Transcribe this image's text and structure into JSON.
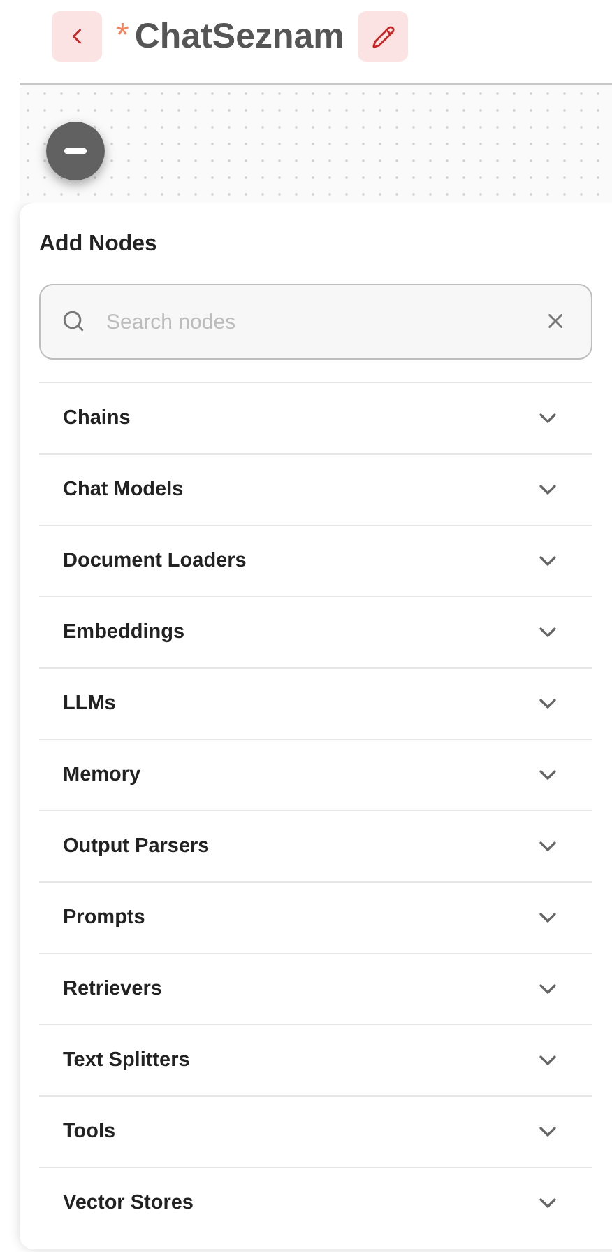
{
  "header": {
    "unsaved_mark": "*",
    "title": "ChatSeznam"
  },
  "panel": {
    "title": "Add Nodes",
    "search": {
      "placeholder": "Search nodes"
    },
    "categories": [
      {
        "label": "Chains",
        "expanded": false
      },
      {
        "label": "Chat Models",
        "expanded": false
      },
      {
        "label": "Document Loaders",
        "expanded": false
      },
      {
        "label": "Embeddings",
        "expanded": false
      },
      {
        "label": "LLMs",
        "expanded": false
      },
      {
        "label": "Memory",
        "expanded": false
      },
      {
        "label": "Output Parsers",
        "expanded": false
      },
      {
        "label": "Prompts",
        "expanded": false
      },
      {
        "label": "Retrievers",
        "expanded": false
      },
      {
        "label": "Text Splitters",
        "expanded": false
      },
      {
        "label": "Tools",
        "expanded": false
      },
      {
        "label": "Vector Stores",
        "expanded": false
      }
    ]
  }
}
